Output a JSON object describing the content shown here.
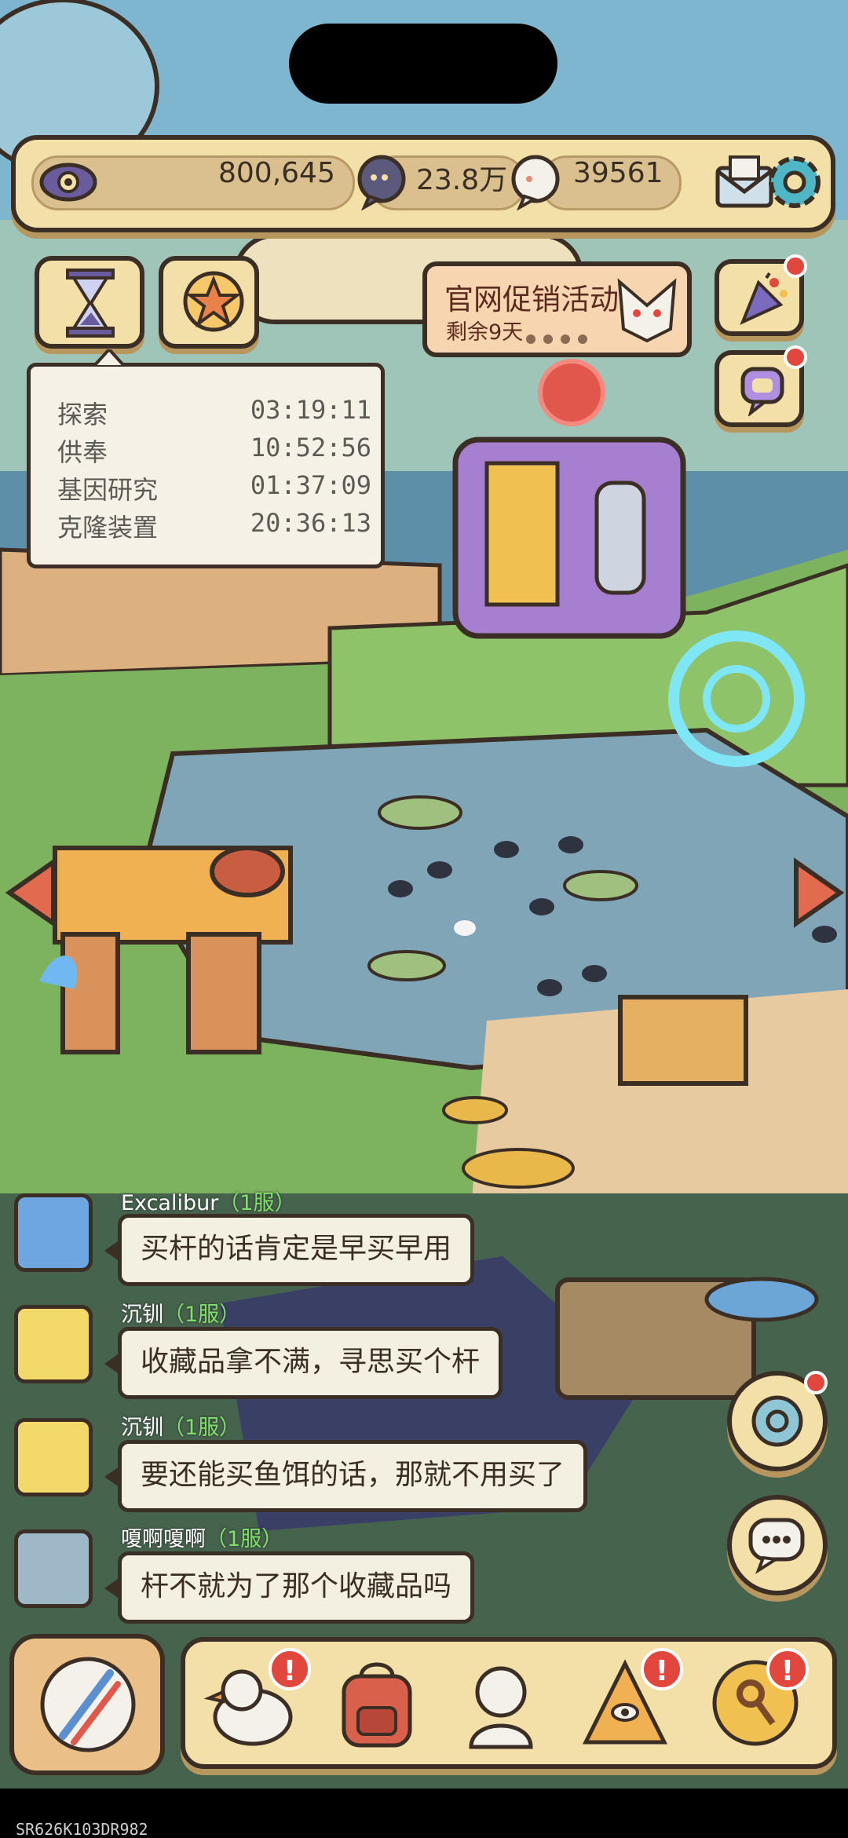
{
  "hud": {
    "views": "800,645",
    "bubbles": "23.8万",
    "speech": "39561"
  },
  "promo": {
    "title": "官网促销活动",
    "subtitle": "剩余9天"
  },
  "timers": [
    {
      "name": "探索",
      "time": "03:19:11"
    },
    {
      "name": "供奉",
      "time": "10:52:56"
    },
    {
      "name": "基因研究",
      "time": "01:37:09"
    },
    {
      "name": "克隆装置",
      "time": "20:36:13"
    }
  ],
  "chat": [
    {
      "user": "Excalibur",
      "server": "（1服）",
      "message": "买杆的话肯定是早买早用"
    },
    {
      "user": "沉钏",
      "server": "（1服）",
      "message": "收藏品拿不满，寻思买个杆"
    },
    {
      "user": "沉钏",
      "server": "（1服）",
      "message": "要还能买鱼饵的话，那就不用买了"
    },
    {
      "user": "嗄啊嗄啊",
      "server": "（1服）",
      "message": "杆不就为了那个收藏品吗"
    }
  ],
  "alerts": {
    "excl": "!"
  },
  "footer": {
    "code": "SR626K103DR982"
  },
  "colors": {
    "panel": "#f3dfa8",
    "outline": "#3a2e25",
    "alert": "#e2473d",
    "server_tag": "#7fe06a",
    "water": "#7fa5b7",
    "grass": "#7db25e"
  },
  "icons": [
    "eye-icon",
    "bubble-icon",
    "speech-icon",
    "mail-icon",
    "gear-icon",
    "hourglass-icon",
    "star-icon",
    "party-popper-icon",
    "chat-bubble-icon",
    "compass-icon",
    "chat-icon",
    "fishing-rod-icon",
    "duck-icon",
    "backpack-icon",
    "statue-icon",
    "pyramid-icon",
    "key-icon"
  ]
}
